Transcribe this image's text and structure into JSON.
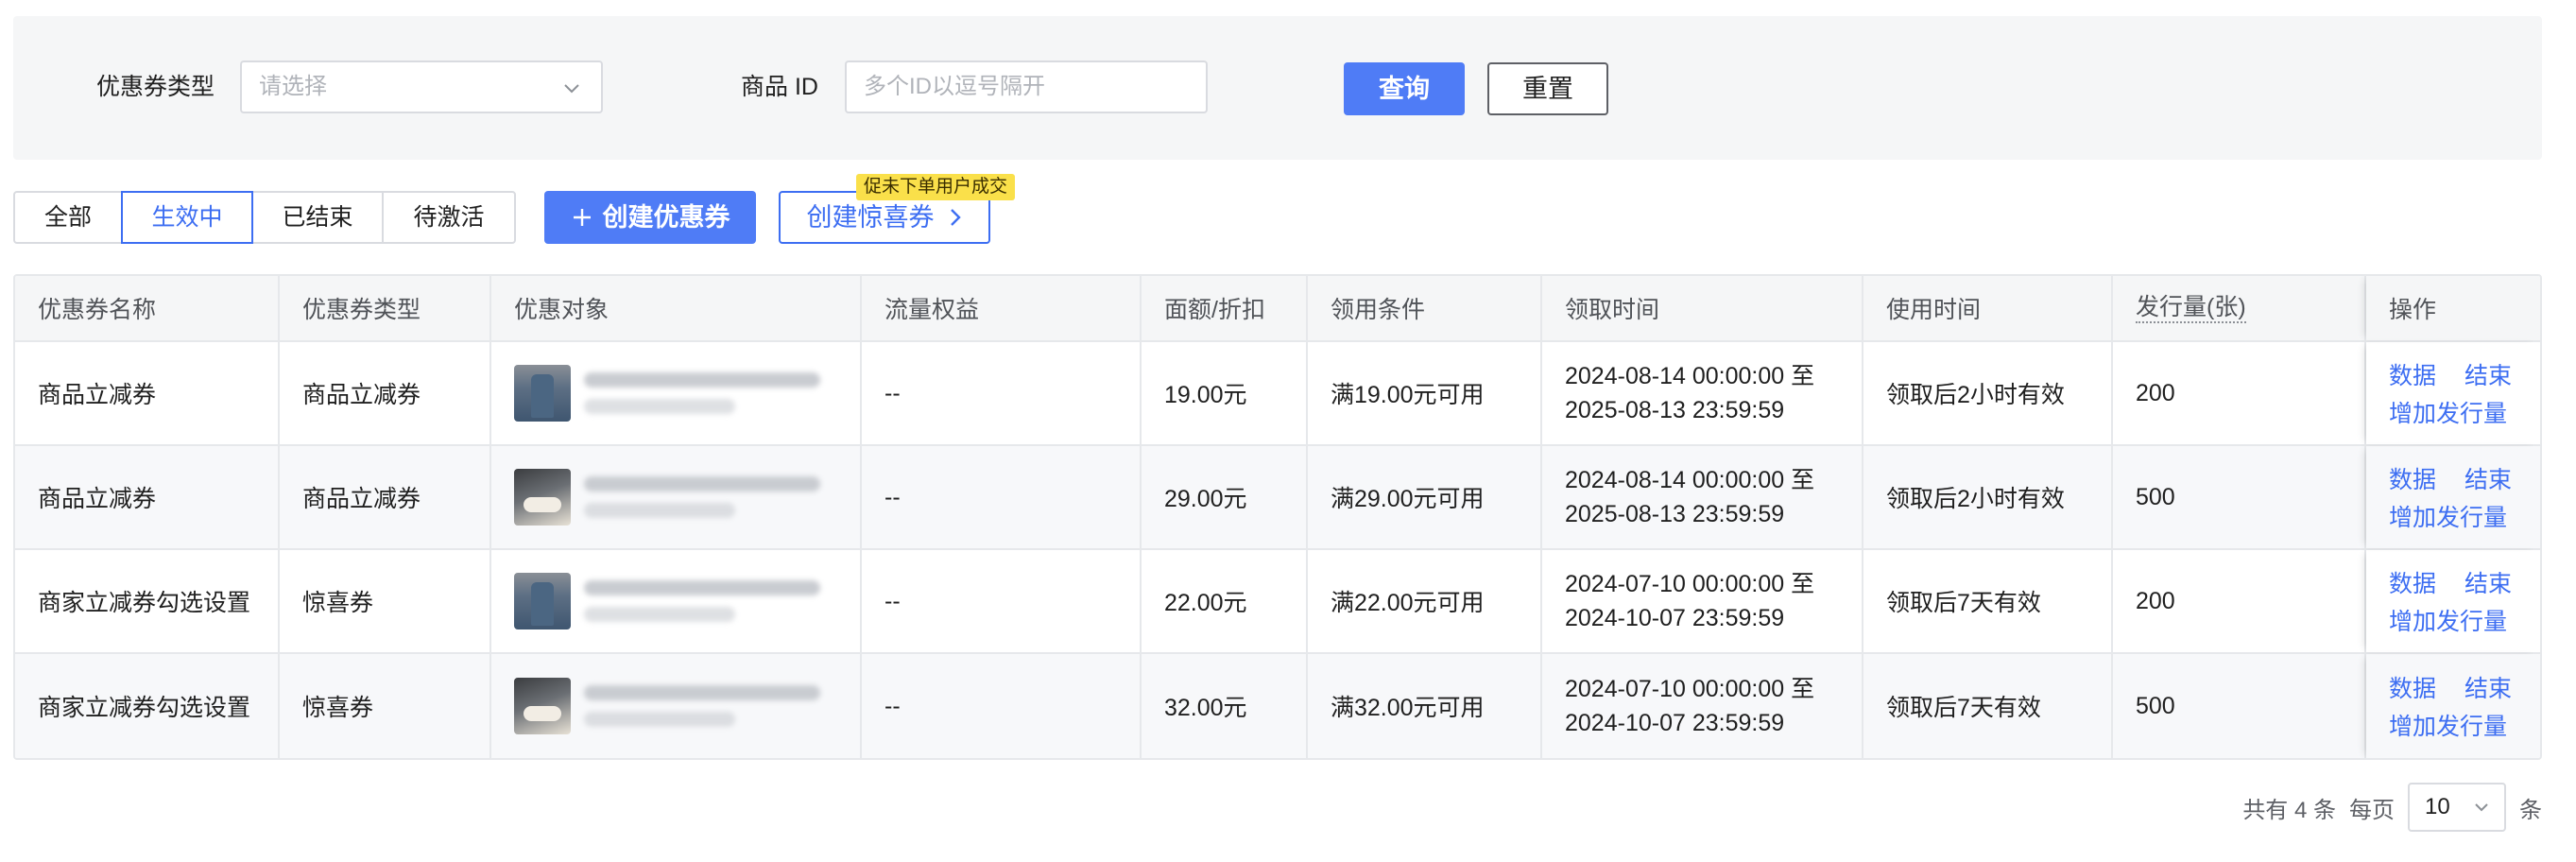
{
  "filters": {
    "coupon_type_label": "优惠券类型",
    "coupon_type_placeholder": "请选择",
    "product_id_label": "商品 ID",
    "product_id_placeholder": "多个ID以逗号隔开",
    "query_label": "查询",
    "reset_label": "重置"
  },
  "tabs": [
    {
      "label": "全部",
      "active": false
    },
    {
      "label": "生效中",
      "active": true
    },
    {
      "label": "已结束",
      "active": false
    },
    {
      "label": "待激活",
      "active": false
    }
  ],
  "actions": {
    "create_coupon_label": "创建优惠券",
    "create_surprise_label": "创建惊喜券",
    "promo_badge": "促未下单用户成交"
  },
  "table": {
    "columns": [
      "优惠券名称",
      "优惠券类型",
      "优惠对象",
      "流量权益",
      "面额/折扣",
      "领用条件",
      "领取时间",
      "使用时间",
      "发行量(张)",
      "操作"
    ],
    "rows": [
      {
        "name": "商品立减券",
        "type": "商品立减券",
        "thumb": "shirt-thumbnail",
        "traffic": "--",
        "amount": "19.00元",
        "condition": "满19.00元可用",
        "claim_start": "2024-08-14 00:00:00 至",
        "claim_end": "2025-08-13 23:59:59",
        "use_time": "领取后2小时有效",
        "quantity": "200"
      },
      {
        "name": "商品立减券",
        "type": "商品立减券",
        "thumb": "shoe-thumbnail",
        "traffic": "--",
        "amount": "29.00元",
        "condition": "满29.00元可用",
        "claim_start": "2024-08-14 00:00:00 至",
        "claim_end": "2025-08-13 23:59:59",
        "use_time": "领取后2小时有效",
        "quantity": "500"
      },
      {
        "name": "商家立减券勾选设置",
        "type": "惊喜券",
        "thumb": "shirt-thumbnail",
        "traffic": "--",
        "amount": "22.00元",
        "condition": "满22.00元可用",
        "claim_start": "2024-07-10 00:00:00 至",
        "claim_end": "2024-10-07 23:59:59",
        "use_time": "领取后7天有效",
        "quantity": "200"
      },
      {
        "name": "商家立减券勾选设置",
        "type": "惊喜券",
        "thumb": "shoe-thumbnail",
        "traffic": "--",
        "amount": "32.00元",
        "condition": "满32.00元可用",
        "claim_start": "2024-07-10 00:00:00 至",
        "claim_end": "2024-10-07 23:59:59",
        "use_time": "领取后7天有效",
        "quantity": "500"
      }
    ],
    "ops": {
      "data": "数据",
      "end": "结束",
      "add_quantity": "增加发行量"
    }
  },
  "pagination": {
    "total_text": "共有 4 条",
    "per_page_label": "每页",
    "per_page_value": "10",
    "unit": "条"
  },
  "colors": {
    "accent": "#4f7cf6",
    "link": "#3d6ef2",
    "badge": "#fae04a"
  }
}
